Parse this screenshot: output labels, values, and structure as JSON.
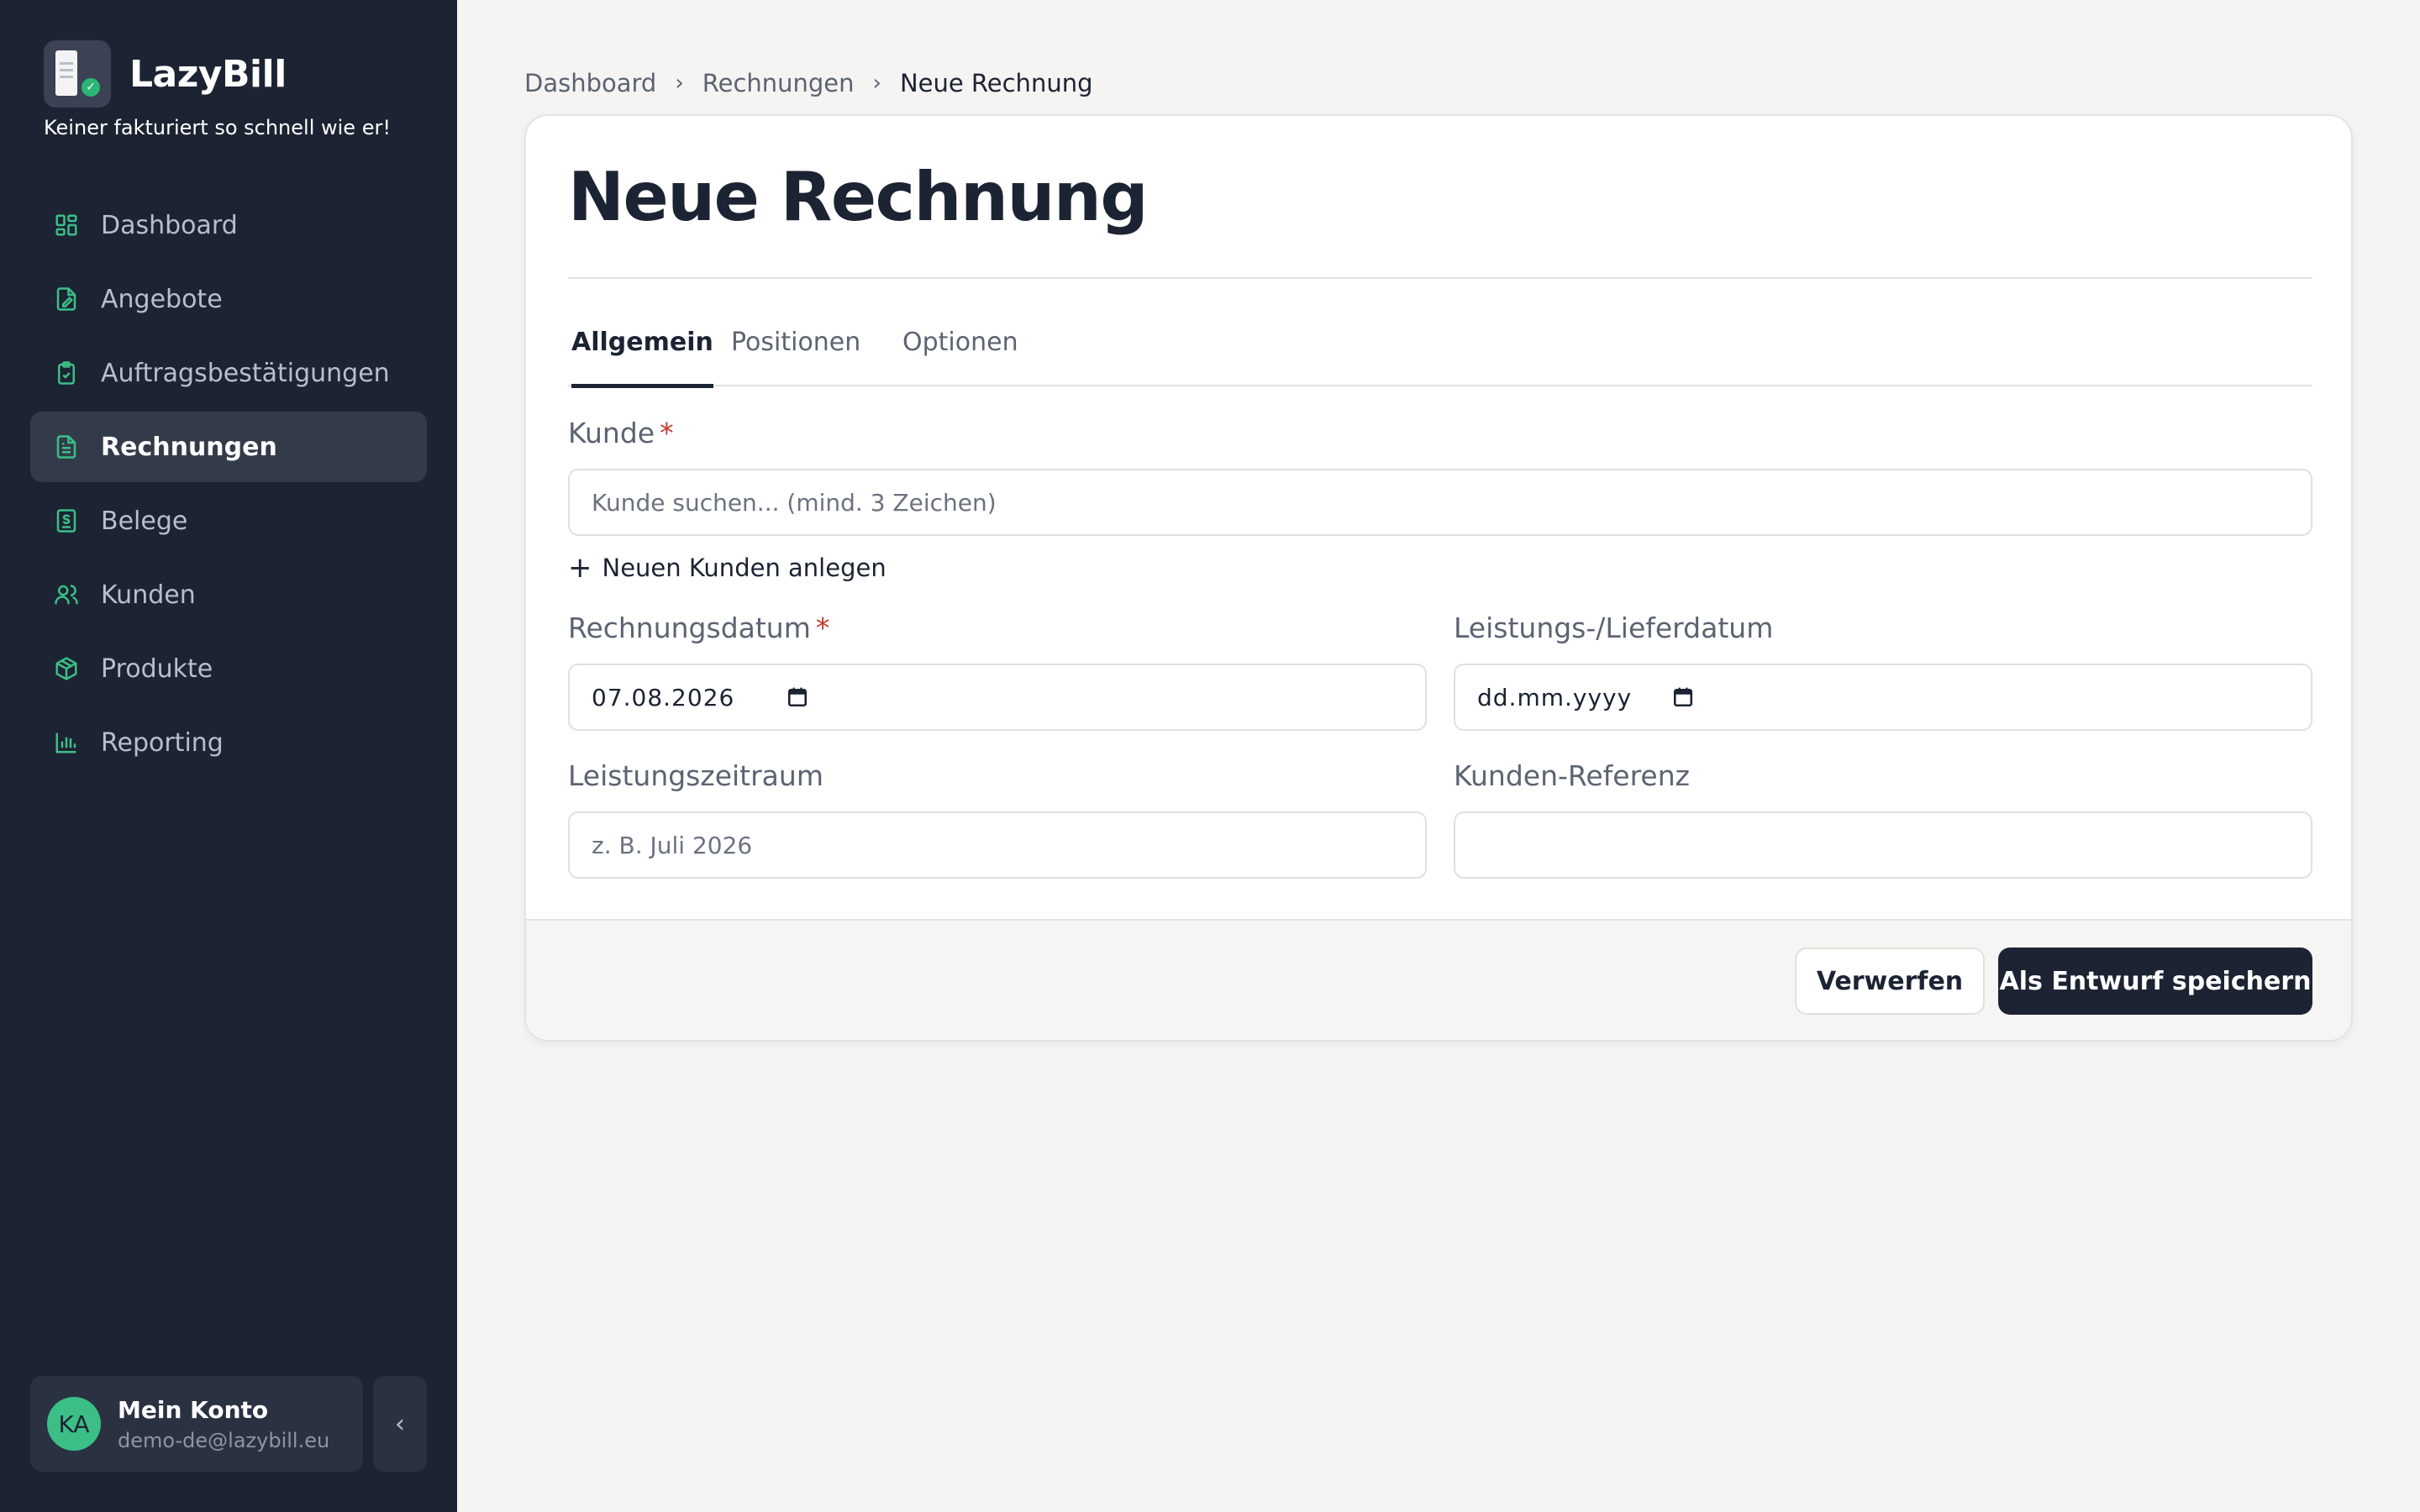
{
  "app": {
    "name": "LazyBill",
    "tagline": "Keiner fakturiert so schnell wie er!"
  },
  "sidebar": {
    "items": [
      {
        "label": "Dashboard",
        "icon": "dashboard-icon"
      },
      {
        "label": "Angebote",
        "icon": "offer-icon"
      },
      {
        "label": "Auftragsbestätigungen",
        "icon": "clipboard-check-icon"
      },
      {
        "label": "Rechnungen",
        "icon": "invoice-icon",
        "active": true
      },
      {
        "label": "Belege",
        "icon": "receipt-icon"
      },
      {
        "label": "Kunden",
        "icon": "users-icon"
      },
      {
        "label": "Produkte",
        "icon": "package-icon"
      },
      {
        "label": "Reporting",
        "icon": "bar-chart-icon"
      }
    ],
    "account": {
      "initials": "KA",
      "name": "Mein Konto",
      "email": "demo-de@lazybill.eu"
    },
    "collapse_glyph": "‹"
  },
  "breadcrumb": [
    "Dashboard",
    "Rechnungen",
    "Neue Rechnung"
  ],
  "page": {
    "title": "Neue Rechnung"
  },
  "tabs": [
    "Allgemein",
    "Positionen",
    "Optionen"
  ],
  "form": {
    "customer_label": "Kunde",
    "customer_placeholder": "Kunde suchen... (mind. 3 Zeichen)",
    "add_customer": "Neuen Kunden anlegen",
    "invoice_date_label": "Rechnungsdatum",
    "invoice_date_value": "07.08.2026",
    "delivery_date_label": "Leistungs-/Lieferdatum",
    "delivery_date_value": "dd.mm.yyyy",
    "period_label": "Leistungszeitraum",
    "period_placeholder": "z. B. Juli 2026",
    "reference_label": "Kunden-Referenz",
    "reference_value": "",
    "required_marker": "*"
  },
  "actions": {
    "discard": "Verwerfen",
    "save_draft": "Als Entwurf speichern"
  },
  "colors": {
    "sidebar_bg": "#1c2333",
    "accent_green": "#3bbf87",
    "page_bg": "#f5f4f2",
    "primary_button": "#1c2333",
    "required": "#c0392b"
  }
}
